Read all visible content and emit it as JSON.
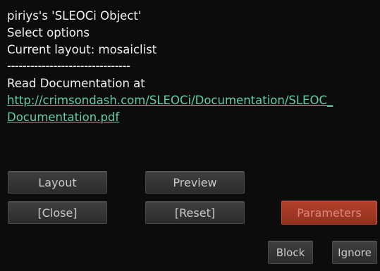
{
  "dialog": {
    "lines": [
      "piriys's 'SLEOCi Object'",
      "Select options",
      "Current layout: mosaiclist",
      "--------------------------------",
      "Read Documentation at"
    ],
    "link_lines": [
      "http://crimsondash.com/SLEOCi/Documentation/SLEOC_",
      "Documentation.pdf"
    ]
  },
  "buttons": {
    "layout": "Layout",
    "preview": "Preview",
    "close": "[Close]",
    "reset": "[Reset]",
    "parameters": "Parameters",
    "block": "Block",
    "ignore": "Ignore"
  },
  "colors": {
    "background": "#0c0c0c",
    "link": "#5fcfa6",
    "accent_button": "#a33a26"
  }
}
